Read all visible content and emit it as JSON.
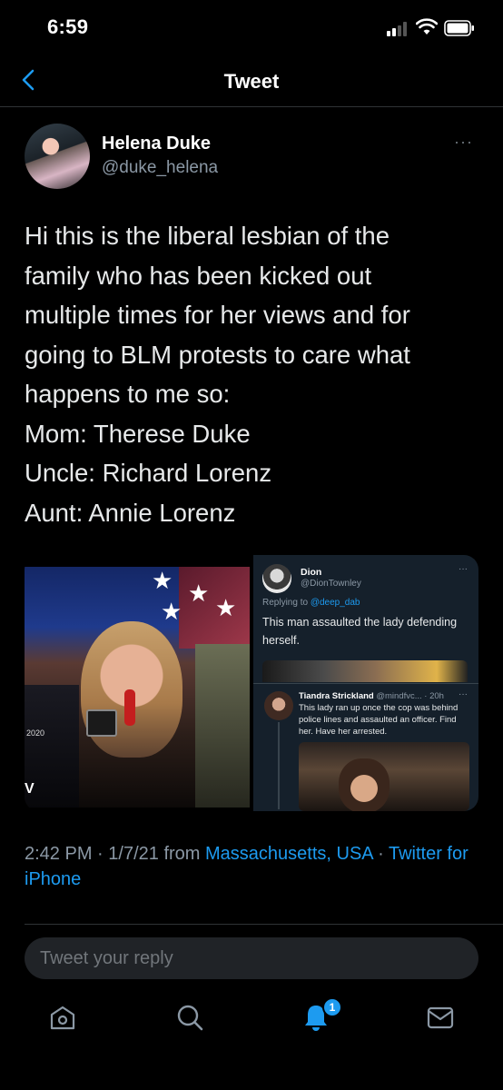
{
  "status_bar": {
    "time": "6:59"
  },
  "header": {
    "title": "Tweet"
  },
  "tweet": {
    "author_name": "Helena Duke",
    "author_handle": "@duke_helena",
    "more": "···",
    "text_lines": [
      "Hi this is the liberal lesbian of the",
      "family who has been kicked out",
      "multiple times for her views and for",
      "going to BLM protests to care what",
      "happens to me so:",
      "Mom: Therese Duke",
      "Uncle: Richard Lorenz",
      "Aunt: Annie Lorenz"
    ],
    "meta": {
      "time": "2:42 PM",
      "date": "1/7/21",
      "from": "from",
      "location": "Massachusetts, USA",
      "client": "Twitter for iPhone"
    }
  },
  "media": {
    "left_photo": {
      "year": "2020",
      "corner": "V"
    },
    "embedded_tweet_1": {
      "name": "Dion",
      "handle": "@DionTownley",
      "more": "···",
      "replying_prefix": "Replying to",
      "replying_to": "@deep_dab",
      "text": "This man assaulted the lady defending herself."
    },
    "embedded_tweet_2": {
      "name": "Tiandra Strickland",
      "handle_time": "@mindfvc... · 20h",
      "more": "···",
      "text": "This lady ran up once the cop was behind police lines and assaulted an officer. Find her. Have her arrested."
    }
  },
  "reply": {
    "placeholder": "Tweet your reply"
  },
  "tabbar": {
    "icons": [
      "home-icon",
      "search-icon",
      "notifications-icon",
      "messages-icon"
    ],
    "notification_badge": "1"
  },
  "colors": {
    "background": "#000000",
    "accent": "#1d9bf0",
    "secondary_text": "#8b98a5"
  }
}
